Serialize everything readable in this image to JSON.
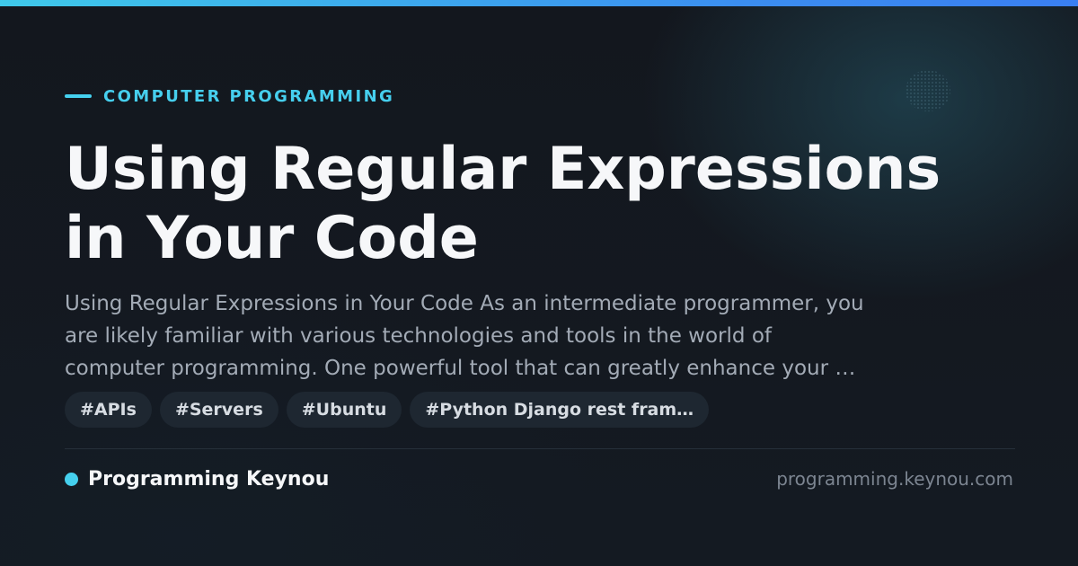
{
  "category": "COMPUTER PROGRAMMING",
  "title_lines": [
    "Using Regular Expressions",
    "in Your Code"
  ],
  "excerpt_lines": [
    "Using Regular Expressions in Your Code As an intermediate programmer, you",
    "are likely familiar with various technologies and tools in the world of",
    "computer programming. One powerful tool that can greatly enhance your …"
  ],
  "tags": [
    "#APIs",
    "#Servers",
    "#Ubuntu",
    "#Python Django rest fram…"
  ],
  "brand": {
    "name": "Programming Keynou",
    "domain": "programming.keynou.com"
  },
  "colors": {
    "accent": "#45d0ee",
    "background": "#12161d",
    "title": "#f6f7f9",
    "excerpt": "#a3abb6",
    "tag_bg": "#1e2731",
    "gradient_start": "#3fc9ea",
    "gradient_end": "#3a7ff2"
  }
}
